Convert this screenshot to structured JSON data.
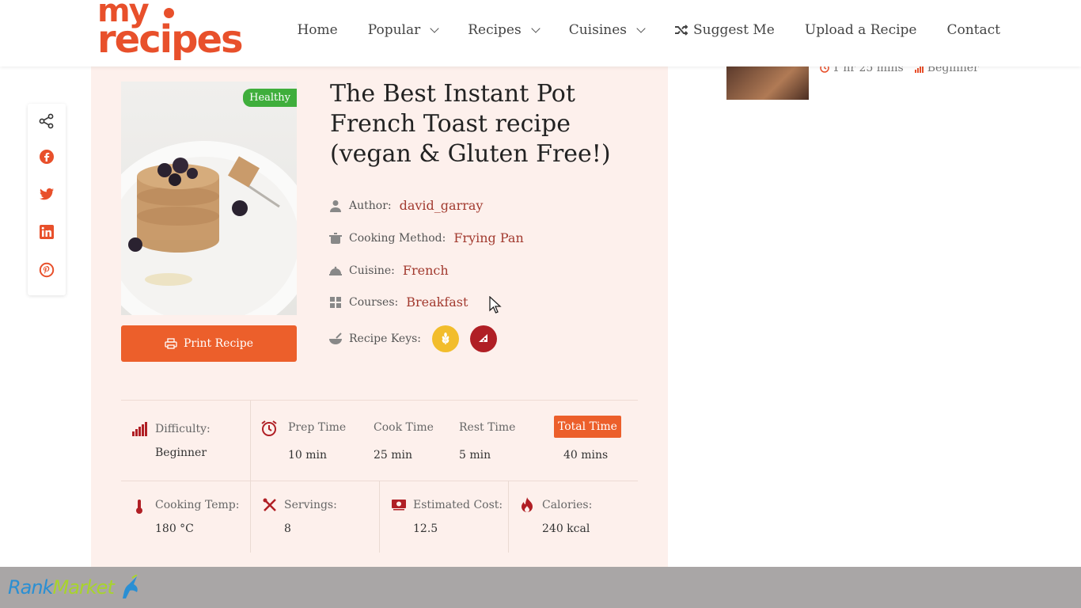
{
  "header": {
    "logo_line1": "my",
    "logo_line2": "recipes",
    "nav": [
      {
        "label": "Home"
      },
      {
        "label": "Popular"
      },
      {
        "label": "Recipes"
      },
      {
        "label": "Cuisines"
      },
      {
        "label": "Suggest Me"
      },
      {
        "label": "Upload a Recipe"
      },
      {
        "label": "Contact"
      }
    ]
  },
  "sidebar_recipe": {
    "time": "1 hr 25 mins",
    "difficulty": "Beginner"
  },
  "recipe": {
    "badge": "Healthy",
    "title": "The Best Instant Pot French Toast recipe (vegan & Gluten Free!)",
    "print_label": "Print Recipe",
    "author_label": "Author:",
    "author": "david_garray",
    "method_label": "Cooking Method:",
    "method": "Frying Pan",
    "cuisine_label": "Cuisine:",
    "cuisine": "French",
    "courses_label": "Courses:",
    "courses": "Breakfast",
    "keys_label": "Recipe Keys:"
  },
  "stats": {
    "difficulty_label": "Difficulty:",
    "difficulty": "Beginner",
    "prep_label": "Prep Time",
    "prep": "10 min",
    "cook_label": "Cook Time",
    "cook": "25 min",
    "rest_label": "Rest Time",
    "rest": "5 min",
    "total_label": "Total Time",
    "total": "40 mins",
    "temp_label": "Cooking Temp:",
    "temp": "180 °C",
    "servings_label": "Servings:",
    "servings": "8",
    "cost_label": "Estimated Cost:",
    "cost": "12.5",
    "calories_label": "Calories:",
    "calories": "240 kcal"
  },
  "footer": {
    "brand_part1": "Rank",
    "brand_part2": "Market"
  },
  "colors": {
    "accent": "#ec5f2b",
    "brand": "#e8502b",
    "link": "#a23a2f",
    "badge_green": "#3fae3c",
    "card_bg": "#fdf0ec"
  }
}
